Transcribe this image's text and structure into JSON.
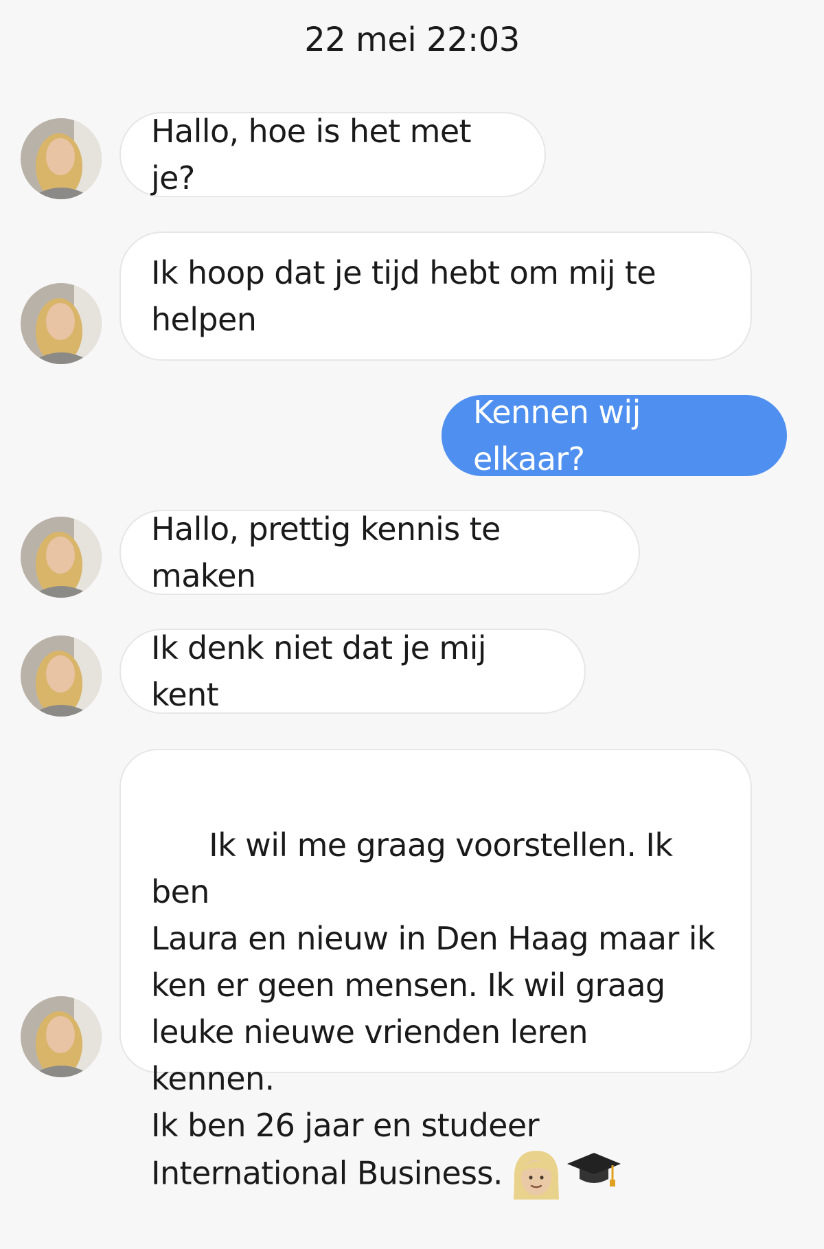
{
  "conversation": {
    "timestamp": "22 mei 22:03",
    "messages": [
      {
        "direction": "incoming",
        "text": "Hallo, hoe is het met je?"
      },
      {
        "direction": "incoming",
        "text": "Ik hoop dat je tijd hebt om mij te\nhelpen"
      },
      {
        "direction": "outgoing",
        "text": "Kennen wij elkaar?"
      },
      {
        "direction": "incoming",
        "text": "Hallo, prettig kennis te maken"
      },
      {
        "direction": "incoming",
        "text": "Ik denk niet dat je mij kent"
      },
      {
        "direction": "incoming",
        "text": "Ik wil me graag voorstellen. Ik ben\nLaura en nieuw in Den Haag maar ik\nken er geen mensen. Ik wil graag\nleuke nieuwe vrienden leren kennen.\nIk ben 26 jaar en studeer\nInternational Business.",
        "emojis": [
          "woman-blonde-emoji",
          "graduation-cap-emoji"
        ]
      }
    ]
  },
  "colors": {
    "background": "#f7f7f7",
    "incoming_bubble": "#ffffff",
    "incoming_border": "#e6e6e6",
    "outgoing_bubble": "#4e8ff0",
    "outgoing_text": "#ffffff"
  }
}
